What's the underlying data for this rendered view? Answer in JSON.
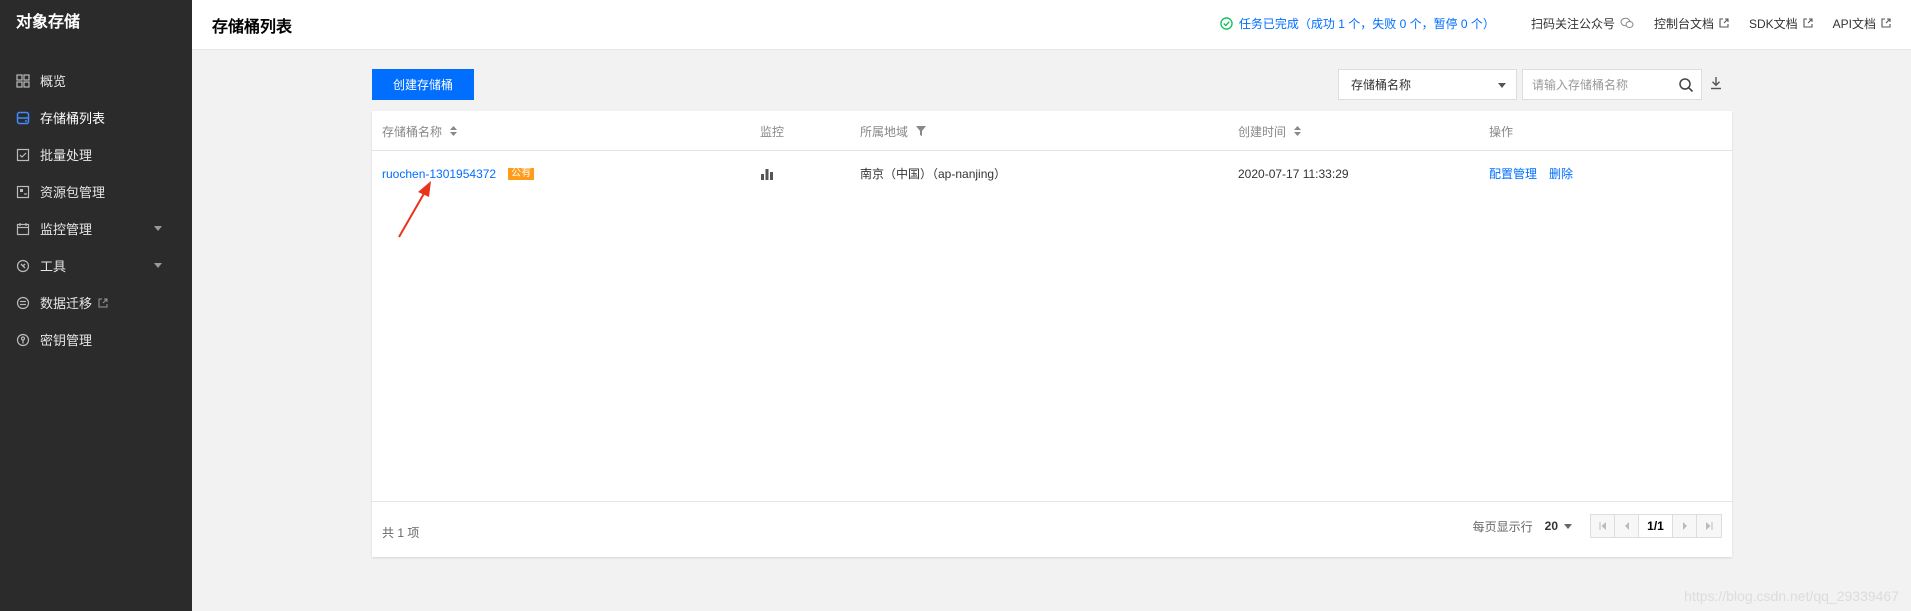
{
  "sidebar": {
    "brand": "对象存储",
    "items": [
      {
        "label": "概览",
        "icon": "grid-icon"
      },
      {
        "label": "存储桶列表",
        "icon": "bucket-icon"
      },
      {
        "label": "批量处理",
        "icon": "batch-icon"
      },
      {
        "label": "资源包管理",
        "icon": "package-icon"
      },
      {
        "label": "监控管理",
        "icon": "calendar-icon"
      },
      {
        "label": "工具",
        "icon": "tool-icon"
      },
      {
        "label": "数据迁移",
        "icon": "migrate-icon"
      },
      {
        "label": "密钥管理",
        "icon": "key-icon"
      }
    ]
  },
  "header": {
    "title": "存储桶列表",
    "task_status": "任务已完成（成功 1 个，失败 0 个，暂停 0 个）",
    "links": [
      "扫码关注公众号",
      "控制台文档",
      "SDK文档",
      "API文档"
    ]
  },
  "toolbar": {
    "create_button": "创建存储桶",
    "filter_select": "存储桶名称",
    "search_placeholder": "请输入存储桶名称"
  },
  "table": {
    "columns": [
      "存储桶名称",
      "监控",
      "所属地域",
      "创建时间",
      "操作"
    ],
    "rows": [
      {
        "name": "ruochen-1301954372",
        "badge": "公有",
        "region": "南京（中国）（ap-nanjing）",
        "created": "2020-07-17 11:33:29",
        "actions": [
          "配置管理",
          "删除"
        ]
      }
    ]
  },
  "footer": {
    "total": "共 1 项",
    "per_page_label": "每页显示行",
    "per_page_value": "20",
    "page": "1/1"
  },
  "watermark": "https://blog.csdn.net/qq_29339467",
  "colors": {
    "accent": "#006eff",
    "sidebar_bg": "#2b2b2b",
    "badge": "#ff9c19",
    "success": "#0abf5b",
    "annotation_arrow": "#e8341c"
  }
}
